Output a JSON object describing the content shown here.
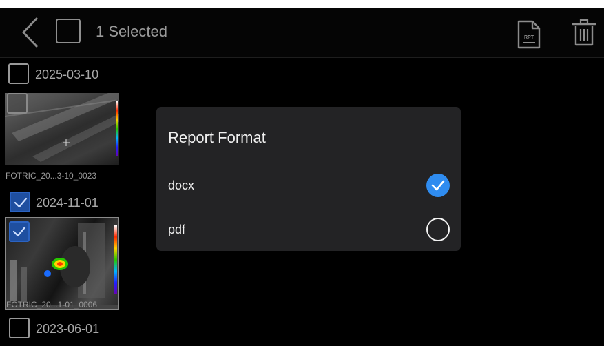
{
  "header": {
    "selected_text": "1 Selected",
    "back_icon": "chevron-left-icon",
    "report_icon": "rpt-document-icon",
    "report_icon_text": "RPT",
    "delete_icon": "trash-icon"
  },
  "gallery": {
    "groups": [
      {
        "date": "2025-03-10",
        "checked": false,
        "thumb_file": "FOTRIC_20...3-10_0023"
      },
      {
        "date": "2024-11-01",
        "checked": true,
        "thumb_file": "FOTRIC_20...1-01_0006"
      },
      {
        "date": "2023-06-01",
        "checked": false
      }
    ]
  },
  "dialog": {
    "title": "Report Format",
    "options": [
      {
        "label": "docx",
        "selected": true
      },
      {
        "label": "pdf",
        "selected": false
      }
    ]
  },
  "colors": {
    "accent": "#2f8cf0",
    "checkbox_checked": "#1f4fa0",
    "dialog_bg": "#232325"
  }
}
